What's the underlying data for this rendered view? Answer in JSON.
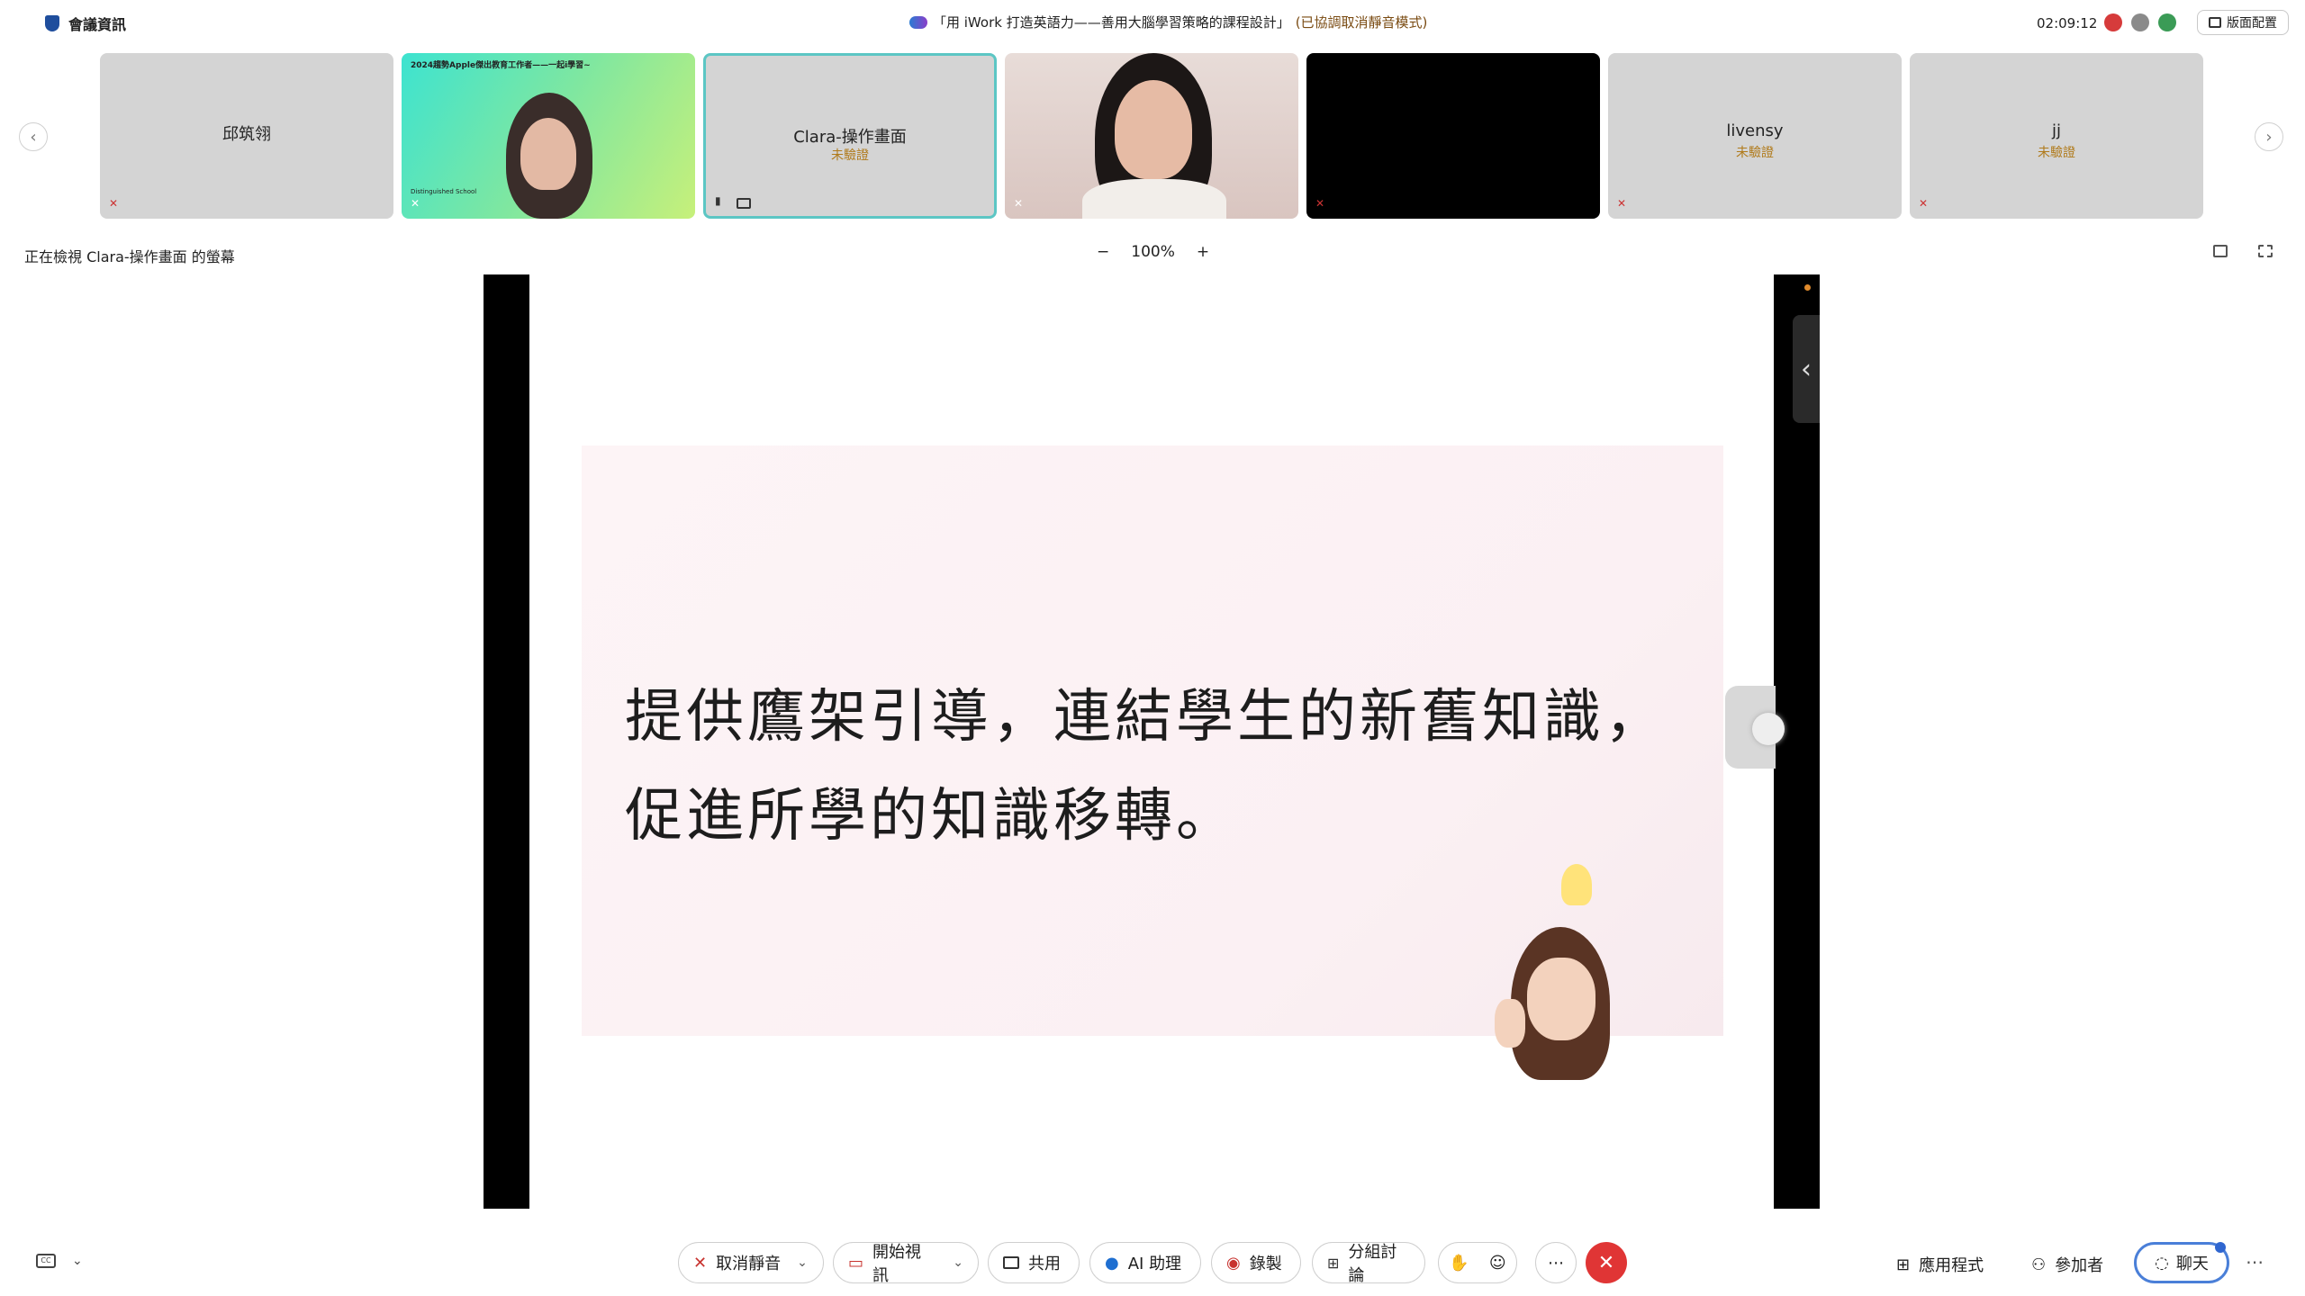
{
  "topbar": {
    "meeting_info": "會議資訊",
    "title": "「用 iWork 打造英語力——善用大腦學習策略的課程設計」",
    "status": "(已協調取消靜音模式)",
    "timer": "02:09:12",
    "layout_button": "版面配置"
  },
  "tiles": [
    {
      "name": "邱筑翎",
      "verified": ""
    },
    {
      "name": "",
      "verified": "",
      "banner": "2024趨勢Apple傑出教育工作者——一起i學習~",
      "school": "Distinguished School"
    },
    {
      "name": "Clara-操作畫面",
      "verified": "未驗證"
    },
    {
      "name": "",
      "verified": ""
    },
    {
      "name": "",
      "verified": ""
    },
    {
      "name": "livensy",
      "verified": "未驗證"
    },
    {
      "name": "jj",
      "verified": "未驗證"
    }
  ],
  "share": {
    "viewing_label": "正在檢視 Clara-操作畫面 的螢幕",
    "zoom": "100%",
    "slide_line1": "提供鷹架引導，連結學生的新舊知識，",
    "slide_line2": "促進所學的知識移轉。"
  },
  "toolbar": {
    "unmute": "取消靜音",
    "start_video": "開始視訊",
    "share": "共用",
    "ai": "AI 助理",
    "record": "錄製",
    "breakout": "分組討論",
    "apps": "應用程式",
    "participants": "參加者",
    "chat": "聊天"
  }
}
